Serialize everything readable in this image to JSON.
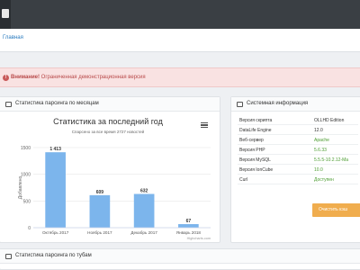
{
  "breadcrumb": {
    "home": "Главная"
  },
  "alert": {
    "strong": "Внимание!",
    "text": "Ограниченная демонстрационная версия"
  },
  "stats_panel": {
    "title": "Статистика парсинга по месяцам",
    "chart_title": "Статистика за последний год",
    "chart_subtitle": "Спарсено за все время 2727 новостей",
    "ylabel": "Добавлено",
    "credit": "Highcharts.com"
  },
  "chart_data": {
    "type": "bar",
    "categories": [
      "Октябрь 2017",
      "Ноябрь 2017",
      "Декабрь 2017",
      "Январь 2018"
    ],
    "values": [
      1413,
      609,
      632,
      67
    ],
    "data_labels": [
      "1 413",
      "609",
      "632",
      "67"
    ],
    "ylim": [
      0,
      1500
    ],
    "yticks": [
      "0",
      "500",
      "1000",
      "1500"
    ],
    "ylabel": "Добавлено",
    "bar_color": "#7cb5ec",
    "grid": true
  },
  "sys_panel": {
    "title": "Системная информация",
    "rows": [
      {
        "key": "Версия скрипта",
        "value": "OLLHD Edition"
      },
      {
        "key": "DataLife Engine",
        "value": "12.0"
      },
      {
        "key": "Веб-сервер",
        "value": "Apache"
      },
      {
        "key": "Версия PHP",
        "value": "5.6.33"
      },
      {
        "key": "Версия MySQL",
        "value": "5.5.5-10.2.12-Ma"
      },
      {
        "key": "Версия IonCube",
        "value": "10.0"
      },
      {
        "key": "Curl",
        "value": "Доступен"
      }
    ],
    "clear_button": "Очистить кэш"
  },
  "tube_panel": {
    "title": "Статистика парсинга по тубам"
  },
  "colors": {
    "topbar": "#3a3f44",
    "link": "#2a7bbf",
    "alert_bg": "#f9e2e2",
    "alert_text": "#b84a4a",
    "ok": "#4a9b2f",
    "button": "#f0ad4e"
  }
}
